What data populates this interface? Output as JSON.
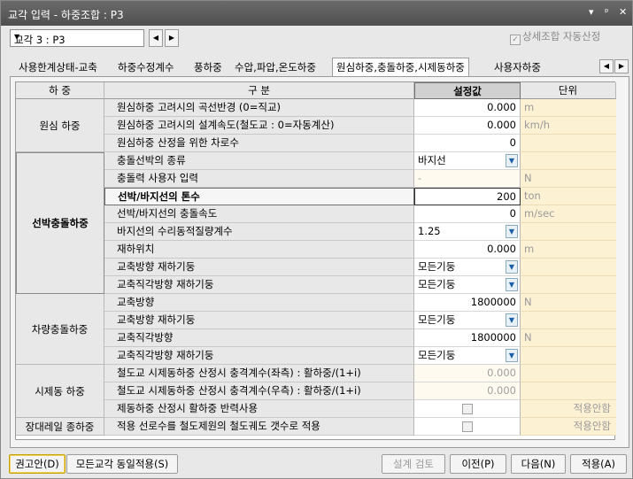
{
  "window": {
    "title": "교각 입력 - 하중조합 : P3",
    "controls": [
      "▾",
      "ᵖ",
      "✕"
    ]
  },
  "toolbar": {
    "case_select": "교각 3 : P3",
    "prev": "◀",
    "next": "▶",
    "auto_combo_label": "상세조합 자동산정",
    "auto_combo_checked": true
  },
  "tabs": {
    "items": [
      "사용한계상태-교축",
      "하중수정계수",
      "풍하중",
      "수압,파압,온도하중",
      "원심하중,충돌하중,시제동하중",
      "사용자하중"
    ],
    "active_index": 4
  },
  "grid": {
    "headers": {
      "group": "하 중",
      "item": "구 분",
      "value": "설정값",
      "unit": "단위"
    },
    "groups": [
      "원심 하중",
      "선박충돌하중",
      "차량충돌하중",
      "시제동 하중",
      "장대레일 종하중"
    ],
    "rows": [
      {
        "label": "원심하중 고려시의 곡선반경 (0=직교)",
        "value": "0.000",
        "unit": "m"
      },
      {
        "label": "원심하중 고려시의 설계속도(철도교 : 0=자동계산)",
        "value": "0.000",
        "unit": "km/h"
      },
      {
        "label": "원심하중 산정을 위한 차로수",
        "value": "0",
        "unit": ""
      },
      {
        "label": "충돌선박의 종류",
        "value": "바지선",
        "unit": ""
      },
      {
        "label": "충돌력 사용자 입력",
        "value": "-",
        "unit": "N"
      },
      {
        "label": "선박/바지선의 톤수",
        "value": "200",
        "unit": "ton"
      },
      {
        "label": "선박/바지선의 충돌속도",
        "value": "0",
        "unit": "m/sec"
      },
      {
        "label": "바지선의 수리동적질량계수",
        "value": "1.25",
        "unit": ""
      },
      {
        "label": "재하위치",
        "value": "0.000",
        "unit": "m"
      },
      {
        "label": "교축방향 재하기둥",
        "value": "모든기둥",
        "unit": ""
      },
      {
        "label": "교축직각방향 재하기둥",
        "value": "모든기둥",
        "unit": ""
      },
      {
        "label": "교축방향",
        "value": "1800000",
        "unit": "N"
      },
      {
        "label": "교축방향 재하기둥",
        "value": "모든기둥",
        "unit": ""
      },
      {
        "label": "교축직각방향",
        "value": "1800000",
        "unit": "N"
      },
      {
        "label": "교축직각방향 재하기둥",
        "value": "모든기둥",
        "unit": ""
      },
      {
        "label": "철도교 시제동하중 산정시 충격계수(좌측) : 활하중/(1+i)",
        "value": "0.000",
        "unit": ""
      },
      {
        "label": "철도교 시제동하중 산정시 충격계수(우측) : 활하중/(1+i)",
        "value": "0.000",
        "unit": ""
      },
      {
        "label": "제동하중 산정시 활하중 반력사용",
        "value": "",
        "unit": "적용안함"
      },
      {
        "label": "적용 선로수를 철도제원의 철도궤도 갯수로 적용",
        "value": "",
        "unit": "적용안함"
      }
    ]
  },
  "buttons": {
    "recommend": "권고안(D)",
    "apply_all": "모든교각 동일적용(S)",
    "design_check": "설계 검토",
    "prev": "이전(P)",
    "next": "다음(N)",
    "apply": "적용(A)"
  }
}
